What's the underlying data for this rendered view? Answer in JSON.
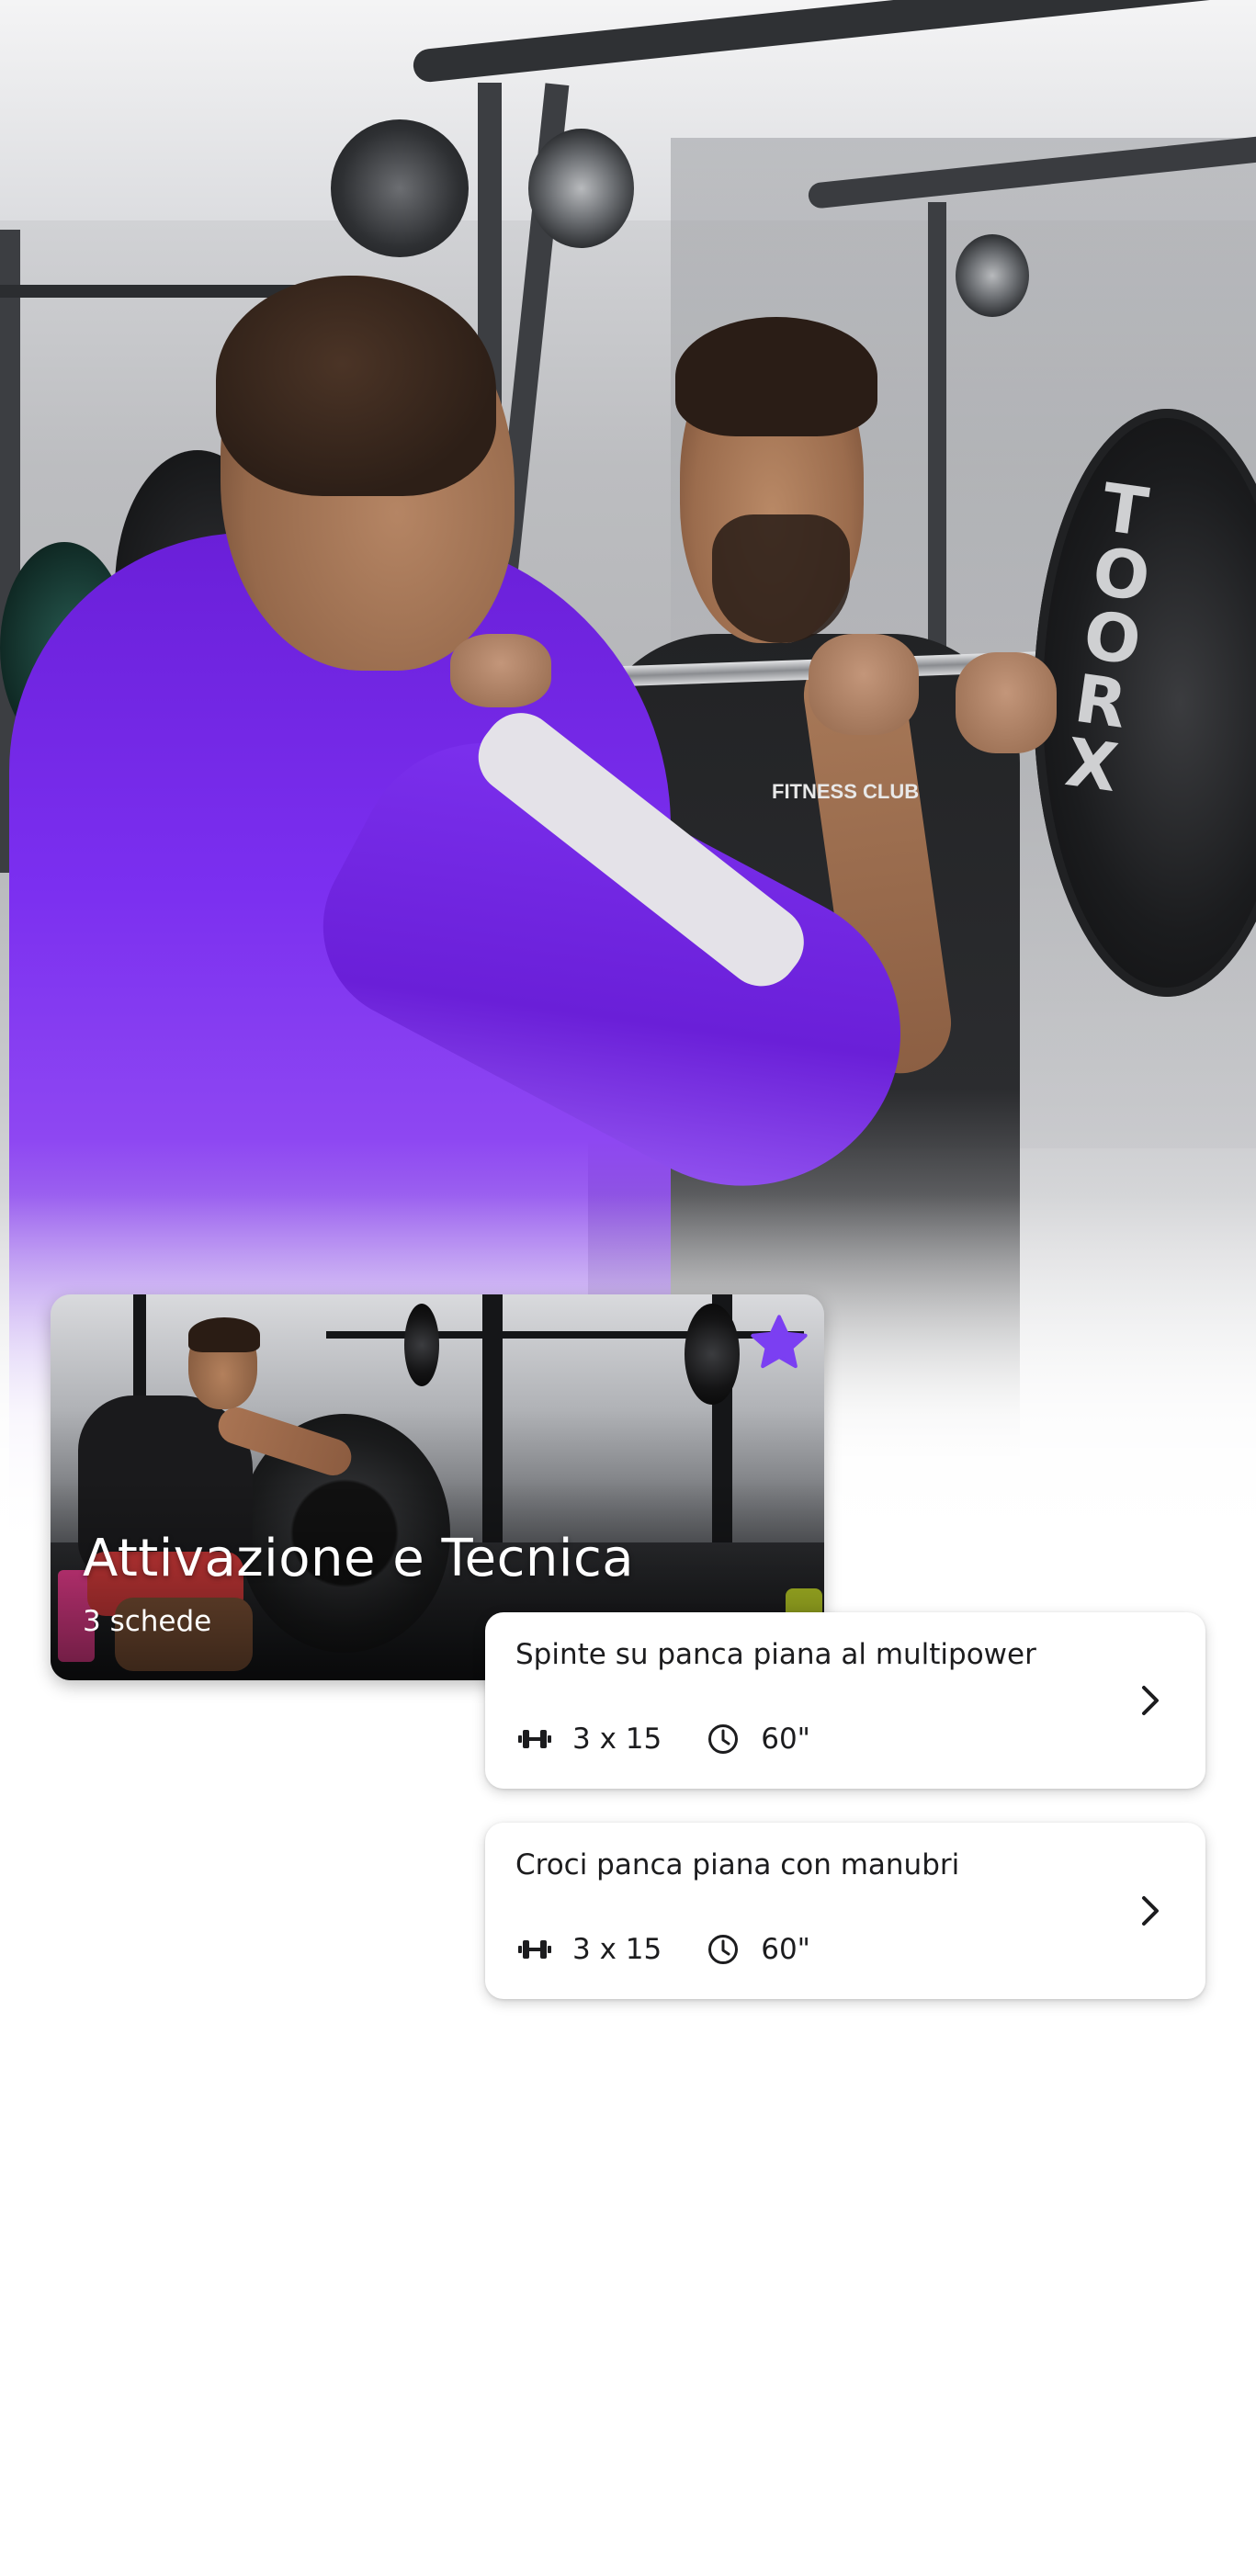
{
  "category": {
    "title": "Attivazione e Tecnica",
    "subtitle": "3 schede",
    "favorite": true,
    "accent_color": "#7b3ff2"
  },
  "exercises": [
    {
      "name": "Spinte su panca piana al multipower",
      "sets_reps": "3 x 15",
      "rest": "60\"",
      "sets_icon": "dumbbell-icon",
      "rest_icon": "clock-icon"
    },
    {
      "name": "Croci panca piana con manubri",
      "sets_reps": "3 x 15",
      "rest": "60\"",
      "sets_icon": "dumbbell-icon",
      "rest_icon": "clock-icon"
    }
  ],
  "hero": {
    "plate_brand": "TOORX",
    "shirt_text": "FITNESS CLUB"
  }
}
